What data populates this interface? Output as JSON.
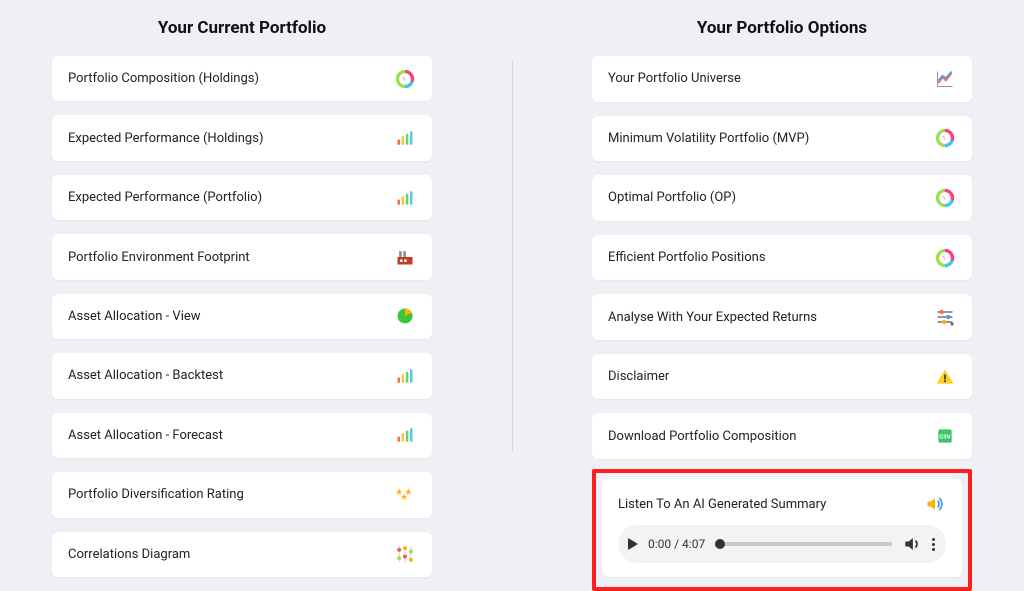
{
  "left": {
    "title": "Your Current Portfolio",
    "items": [
      {
        "label": "Portfolio Composition (Holdings)"
      },
      {
        "label": "Expected Performance (Holdings)"
      },
      {
        "label": "Expected Performance (Portfolio)"
      },
      {
        "label": "Portfolio Environment Footprint"
      },
      {
        "label": "Asset Allocation - View"
      },
      {
        "label": "Asset Allocation - Backtest"
      },
      {
        "label": "Asset Allocation - Forecast"
      },
      {
        "label": "Portfolio Diversification Rating"
      },
      {
        "label": "Correlations Diagram"
      }
    ]
  },
  "right": {
    "title": "Your Portfolio Options",
    "items": [
      {
        "label": "Your Portfolio Universe"
      },
      {
        "label": "Minimum Volatility Portfolio (MVP)"
      },
      {
        "label": "Optimal Portfolio (OP)"
      },
      {
        "label": "Efficient Portfolio Positions"
      },
      {
        "label": "Analyse With Your Expected Returns"
      },
      {
        "label": "Disclaimer"
      },
      {
        "label": "Download Portfolio Composition"
      }
    ],
    "ai": {
      "label": "Listen To An AI Generated Summary",
      "time": "0:00 / 4:07"
    }
  }
}
